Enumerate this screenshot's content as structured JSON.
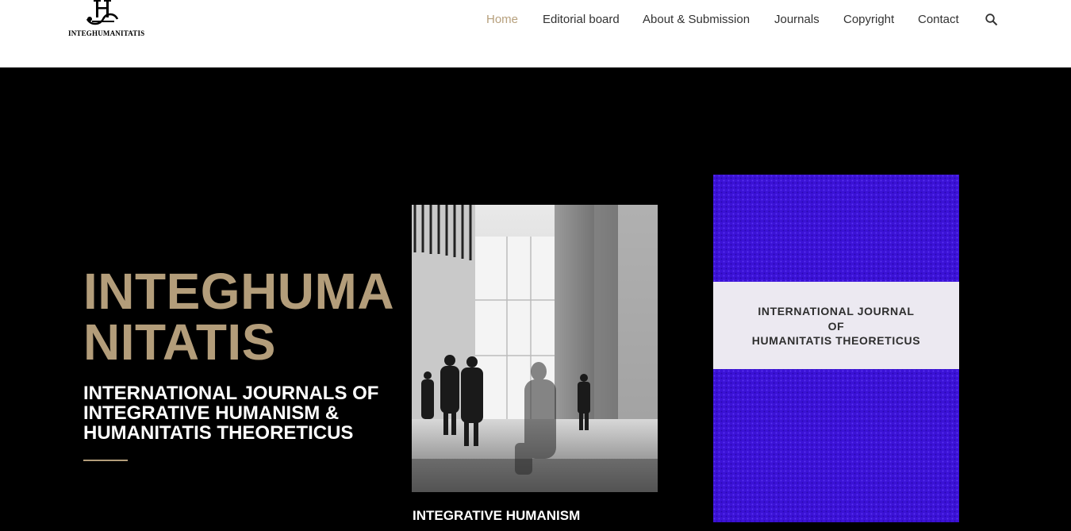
{
  "site": {
    "logo_text": "INTEGHUMANITATIS",
    "logo_letter": "H"
  },
  "nav": {
    "items": [
      {
        "label": "Home",
        "active": true
      },
      {
        "label": "Editorial board",
        "active": false
      },
      {
        "label": "About & Submission",
        "active": false
      },
      {
        "label": "Journals",
        "active": false
      },
      {
        "label": "Copyright",
        "active": false
      },
      {
        "label": "Contact",
        "active": false
      }
    ],
    "search_icon": "search-icon"
  },
  "hero": {
    "title_line1": "INTEGHUMA",
    "title_line2": "NITATIS",
    "subtitle": "INTERNATIONAL JOURNALS OF INTEGRATIVE HUMANISM & HUMANITATIS THEORETICUS"
  },
  "cards": [
    {
      "caption": "INTEGRATIVE HUMANISM"
    },
    {
      "cover_line1": "INTERNATIONAL JOURNAL",
      "cover_line2": "OF",
      "cover_line3": "HUMANITATIS THEORETICUS"
    }
  ],
  "colors": {
    "accent": "#b39d7a",
    "nav_active": "#b7a07d",
    "hero_bg": "#000000",
    "cover_purple": "#3a0fd4"
  }
}
